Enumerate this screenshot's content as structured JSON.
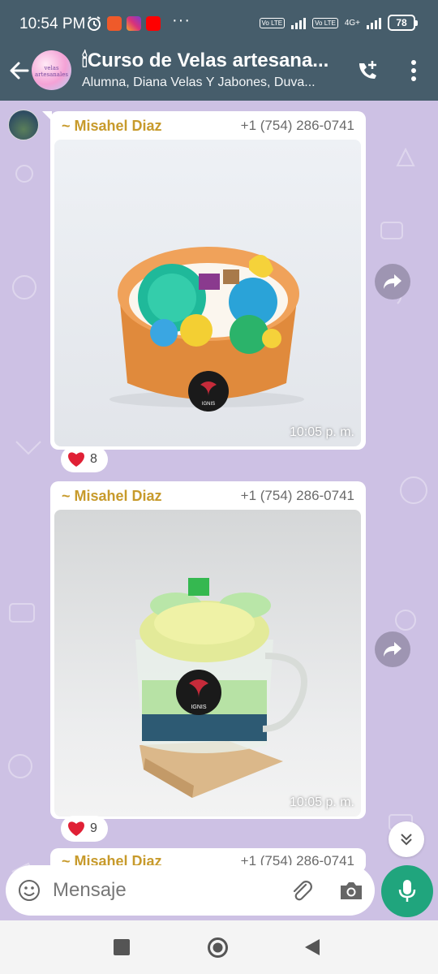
{
  "status_bar": {
    "time": "10:54 PM",
    "dots": "···",
    "volte_1": "Vo LTE",
    "volte_2": "Vo LTE",
    "network": "4G+",
    "battery": "78"
  },
  "header": {
    "title_emoji": "🕯",
    "title": "Curso de Velas artesana...",
    "subtitle": "Alumna, Diana Velas Y Jabones, Duva...",
    "avatar_text": "velas artesanales"
  },
  "messages": [
    {
      "sender": "~ Misahel Diaz",
      "phone": "+1 (754) 286-0741",
      "time": "10:05 p. m.",
      "reaction_emoji": "heart",
      "reaction_count": "8",
      "logo_text": "IGNIS"
    },
    {
      "sender": "~ Misahel Diaz",
      "phone": "+1 (754) 286-0741",
      "time": "10:05 p. m.",
      "reaction_emoji": "heart",
      "reaction_count": "9",
      "logo_text": "IGNIS"
    },
    {
      "sender": "~ Misahel Diaz",
      "phone": "+1 (754) 286-0741"
    }
  ],
  "composer": {
    "placeholder": "Mensaje"
  },
  "colors": {
    "header_bg": "#465d6b",
    "wallpaper": "#cdc1e4",
    "sender_name": "#c79a2b",
    "mic_green": "#20a57d"
  }
}
